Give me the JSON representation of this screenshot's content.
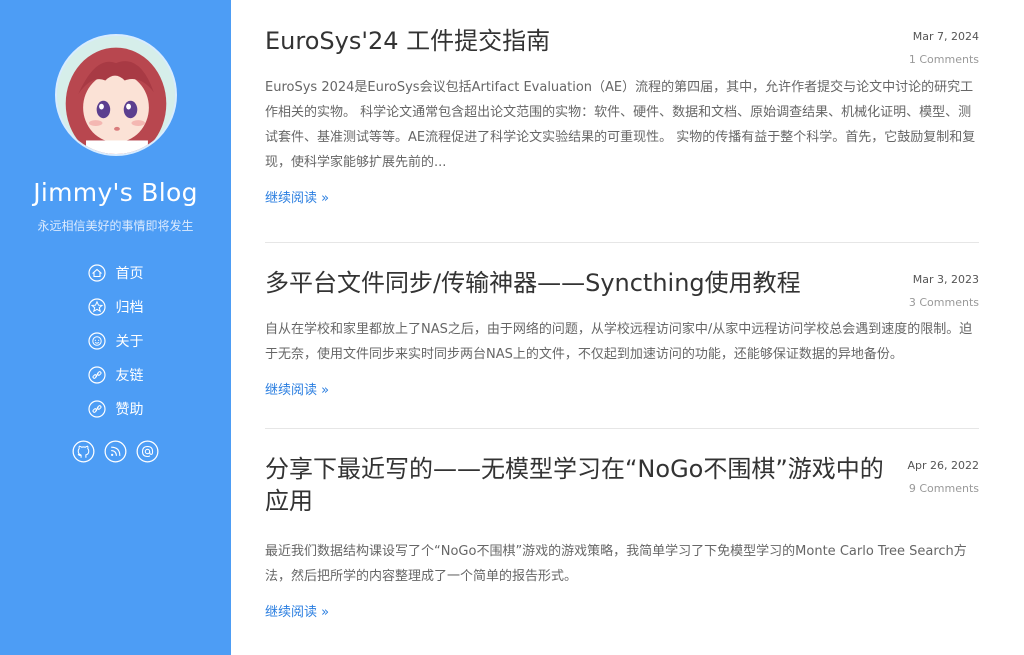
{
  "sidebar": {
    "title": "Jimmy's Blog",
    "description": "永远相信美好的事情即将发生",
    "nav": [
      {
        "label": "首页",
        "icon": "home-icon"
      },
      {
        "label": "归档",
        "icon": "star-icon"
      },
      {
        "label": "关于",
        "icon": "smile-icon"
      },
      {
        "label": "友链",
        "icon": "link-icon"
      },
      {
        "label": "赞助",
        "icon": "link-icon"
      }
    ],
    "social": [
      {
        "icon": "github-icon"
      },
      {
        "icon": "rss-icon"
      },
      {
        "icon": "email-icon"
      }
    ]
  },
  "posts": [
    {
      "title": "EuroSys'24 工件提交指南",
      "date": "Mar 7, 2024",
      "comments": "1 Comments",
      "excerpt": "EuroSys 2024是EuroSys会议包括Artifact Evaluation（AE）流程的第四届，其中，允许作者提交与论文中讨论的研究工作相关的实物。 科学论文通常包含超出论文范围的实物：软件、硬件、数据和文档、原始调查结果、机械化证明、模型、测试套件、基准测试等等。AE流程促进了科学论文实验结果的可重现性。 实物的传播有益于整个科学。首先，它鼓励复制和复现，使科学家能够扩展先前的...",
      "read_more": "继续阅读 »"
    },
    {
      "title": "多平台文件同步/传输神器——Syncthing使用教程",
      "date": "Mar 3, 2023",
      "comments": "3 Comments",
      "excerpt": "自从在学校和家里都放上了NAS之后，由于网络的问题，从学校远程访问家中/从家中远程访问学校总会遇到速度的限制。迫于无奈，使用文件同步来实时同步两台NAS上的文件，不仅起到加速访问的功能，还能够保证数据的异地备份。",
      "read_more": "继续阅读 »"
    },
    {
      "title": "分享下最近写的——无模型学习在“NoGo不围棋”游戏中的应用",
      "date": "Apr 26, 2022",
      "comments": "9 Comments",
      "excerpt": "最近我们数据结构课设写了个“NoGo不围棋”游戏的游戏策略，我简单学习了下免模型学习的Monte Carlo Tree Search方法，然后把所学的内容整理成了一个简单的报告形式。",
      "read_more": "继续阅读 »"
    }
  ],
  "colors": {
    "sidebar_bg": "#4d9df5",
    "link": "#2a7ee0",
    "title": "#333333",
    "text": "#666666"
  }
}
